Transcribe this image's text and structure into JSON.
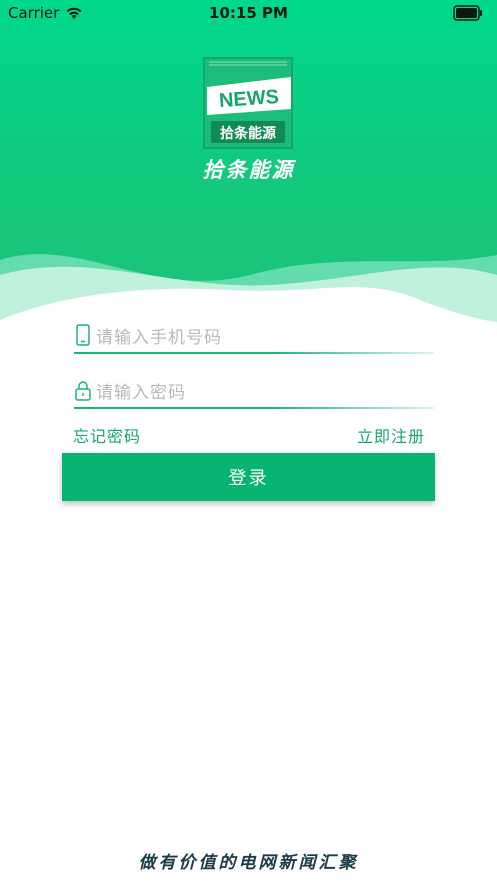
{
  "status_bar": {
    "carrier": "Carrier",
    "time": "10:15 PM",
    "icons": [
      "wifi-icon",
      "battery-icon"
    ]
  },
  "logo": {
    "badge_text": "NEWS",
    "badge_subtitle": "拾条能源",
    "icon": "news-logo"
  },
  "app_name": "拾条能源",
  "form": {
    "phone_placeholder": "请输入手机号码",
    "password_placeholder": "请输入密码",
    "phone_icon": "phone-icon",
    "lock_icon": "lock-icon",
    "forgot_password": "忘记密码",
    "register": "立即注册",
    "login_button": "登录"
  },
  "slogan": "做有价值的电网新闻汇聚",
  "colors": {
    "primary_green": "#07b471",
    "header_green": "#00d88c",
    "link_green": "#16a86a",
    "placeholder_gray": "#b9b9b9"
  }
}
